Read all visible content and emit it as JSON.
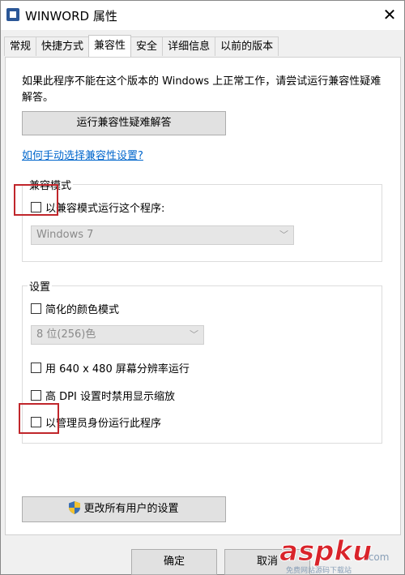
{
  "window": {
    "title": "WINWORD 属性",
    "close_glyph": "✕"
  },
  "tabs": [
    {
      "label": "常规"
    },
    {
      "label": "快捷方式"
    },
    {
      "label": "兼容性"
    },
    {
      "label": "安全"
    },
    {
      "label": "详细信息"
    },
    {
      "label": "以前的版本"
    }
  ],
  "active_tab": "兼容性",
  "compat": {
    "intro": "如果此程序不能在这个版本的 Windows 上正常工作，请尝试运行兼容性疑难解答。",
    "troubleshoot_button": "运行兼容性疑难解答",
    "help_link": "如何手动选择兼容性设置?"
  },
  "compat_mode": {
    "group_label": "兼容模式",
    "checkbox_label": "以兼容模式运行这个程序:",
    "checked": false,
    "os_select_value": "Windows 7"
  },
  "settings": {
    "group_label": "设置",
    "reduced_color": {
      "label": "简化的颜色模式",
      "checked": false
    },
    "color_select_value": "8 位(256)色",
    "res_640": {
      "label": "用 640 x 480 屏幕分辨率运行",
      "checked": false
    },
    "dpi_scaling": {
      "label": "高 DPI 设置时禁用显示缩放",
      "checked": false
    },
    "run_as_admin": {
      "label": "以管理员身份运行此程序",
      "checked": false
    }
  },
  "all_users_button": "更改所有用户的设置",
  "footer": {
    "ok": "确定",
    "cancel": "取消"
  },
  "watermark": {
    "brand": "aspku",
    "sub": ".com",
    "tagline": "免费网站源码下载站"
  },
  "colors": {
    "highlight": "#c0262b",
    "link": "#0066cc",
    "watermark": "#d9232a"
  },
  "icons": {
    "app": "word-app-icon",
    "close": "close-icon",
    "shield": "uac-shield-icon",
    "dropdown": "chevron-down-icon"
  }
}
